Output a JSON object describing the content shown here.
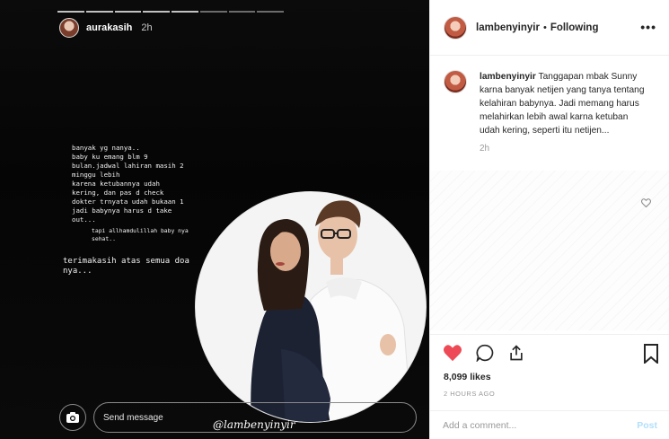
{
  "story": {
    "username": "aurakasih",
    "time": "2h",
    "text_lines": [
      "banyak yg nanya..",
      "baby ku emang blm 9",
      "bulan.jadwal lahiran masih 2",
      "minggu lebih",
      "karena ketubannya udah",
      "kering, dan pas d check",
      "dokter trnyata udah bukaan 1",
      "jadi babynya harus d take",
      "out..."
    ],
    "note": "tapi allhamdulillah baby nya\nsehat..",
    "thanks": "terimakasih atas semua doa\nnya...",
    "watermark": "@lambenyinyir",
    "send_placeholder": "Send message"
  },
  "header": {
    "username": "lambenyinyir",
    "separator": "•",
    "follow_status": "Following",
    "more_icon": "more-horizontal-icon"
  },
  "caption": {
    "username": "lambenyinyir",
    "text": "Tanggapan mbak Sunny karna banyak netijen yang tanya tentang kelahiran babynya. Jadi memang harus melahirkan lebih awal karna ketuban udah kering, seperti itu netijen...",
    "time": "2h"
  },
  "actions": {
    "like_color": "#ed4956",
    "likes": "8,099 likes",
    "posted_ago": "2 HOURS AGO"
  },
  "comment_box": {
    "placeholder": "Add a comment...",
    "post_label": "Post"
  }
}
